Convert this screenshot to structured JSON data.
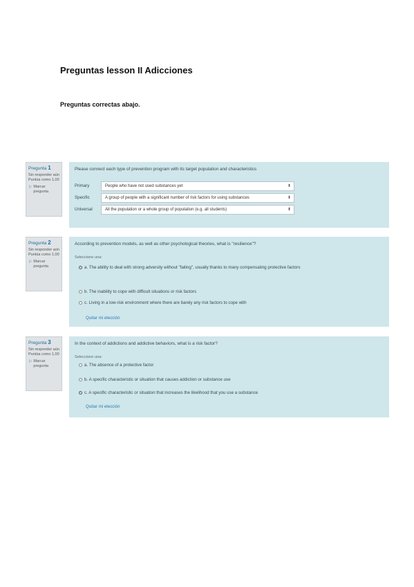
{
  "page": {
    "title": "Preguntas lesson II Adicciones",
    "subtitle": "Preguntas correctas abajo."
  },
  "questions": [
    {
      "label": "Pregunta",
      "number": "1",
      "status": "Sin responder aún",
      "points": "Puntúa como 1,00",
      "flag": "Marcar pregunta",
      "text": "Please connect each type of prevention program with its target population and characteristics",
      "matches": [
        {
          "label": "Primary",
          "value": "People who have not used substances yet"
        },
        {
          "label": "Specific",
          "value": "A group of people with a significant number of risk factors for using substances"
        },
        {
          "label": "Universal",
          "value": "All the population or a whole group of population (e.g. all students)"
        }
      ]
    },
    {
      "label": "Pregunta",
      "number": "2",
      "status": "Sin responder aún",
      "points": "Puntúa como 1,00",
      "flag": "Marcar pregunta",
      "text": "According to prevention models, as well as other psychological theories, what is \"resilience\"?",
      "select_one": "Seleccione una:",
      "options": [
        {
          "prefix": "a.",
          "text": "The ability to deal with strong adversity without \"failing\", usually thanks to many compensating protective factors",
          "selected": true
        },
        {
          "prefix": "b.",
          "text": "The inability to cope with difficult situations or risk factors",
          "selected": false
        },
        {
          "prefix": "c.",
          "text": "Living in a low-risk environment where there are barely any risk factors to cope with",
          "selected": false
        }
      ],
      "clear": "Quitar mi elección"
    },
    {
      "label": "Pregunta",
      "number": "3",
      "status": "Sin responder aún",
      "points": "Puntúa como 1,00",
      "flag": "Marcar pregunta",
      "text": "In the context of addictions and addictive behaviors, what is a risk factor?",
      "select_one": "Seleccione una:",
      "options": [
        {
          "prefix": "a.",
          "text": "The absence of a protective factor",
          "selected": false
        },
        {
          "prefix": "b.",
          "text": "A specific characteristic or situation that causes addiction or substance use",
          "selected": false
        },
        {
          "prefix": "c.",
          "text": "A specific characteristic or situation that increases the likelihood that you use a substance",
          "selected": true
        }
      ],
      "clear": "Quitar mi elección"
    }
  ]
}
